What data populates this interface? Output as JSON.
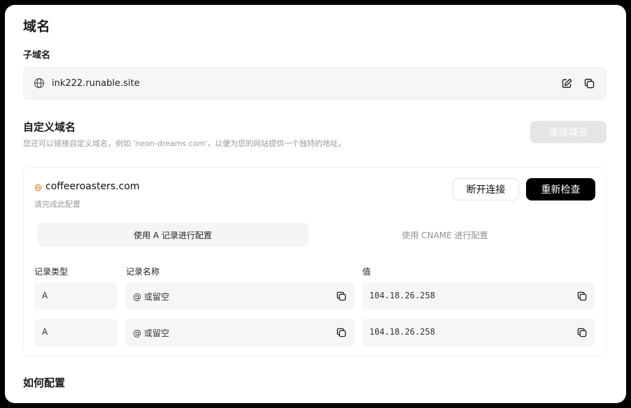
{
  "domain_section": {
    "title": "域名",
    "subdomain_label": "子域名",
    "subdomain_value": "ink222.runable.site"
  },
  "custom_domain": {
    "title": "自定义域名",
    "description": "您还可以链接自定义域名，例如 'neon-dreams.com'，以便为您的网站提供一个独特的地址。",
    "connect_button": "连接域名"
  },
  "domain_entry": {
    "domain": "coffeeroasters.com",
    "hint": "请完成此配置",
    "disconnect_button": "断开连接",
    "recheck_button": "重新检查",
    "tabs": [
      {
        "label": "使用 A 记录进行配置",
        "active": true
      },
      {
        "label": "使用 CNAME 进行配置",
        "active": false
      }
    ],
    "columns": [
      "记录类型",
      "记录名称",
      "值"
    ],
    "records": [
      {
        "type": "A",
        "name": "@ 或留空",
        "value": "104.18.26.258"
      },
      {
        "type": "A",
        "name": "@ 或留空",
        "value": "104.18.26.258"
      }
    ]
  },
  "how_to": {
    "title": "如何配置"
  },
  "icons": {
    "globe": "globe-icon",
    "edit": "edit-icon",
    "copy": "copy-icon",
    "status_globe": "globe-icon"
  },
  "colors": {
    "primary_button": "#000000",
    "disabled_button": "#e5e5e5",
    "status_globe": "#d9a35a"
  }
}
